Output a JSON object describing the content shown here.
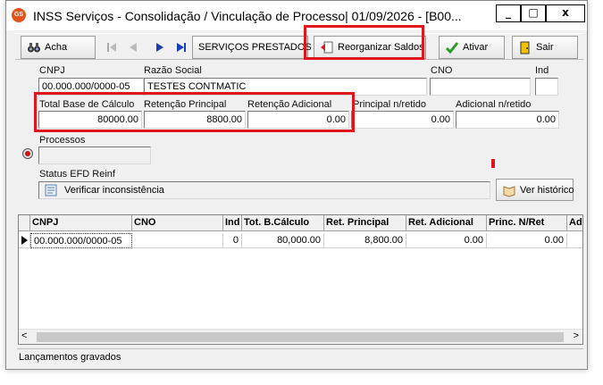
{
  "window": {
    "app_icon_text": "GS",
    "title": "INSS Serviços - Consolidação / Vinculação de Processo|  01/09/2026 - [B00...",
    "controls": {
      "minimize": "_",
      "maximize": "□",
      "close": "x"
    }
  },
  "toolbar": {
    "acha": "Acha",
    "servicos_prestados": "SERVIÇOS PRESTADOS",
    "reorganizar_saldos": "Reorganizar Saldos",
    "ativar": "Ativar",
    "sair": "Sair"
  },
  "form": {
    "cnpj_label": "CNPJ",
    "cnpj_value": "00.000.000/0000-05",
    "razao_social_label": "Razão Social",
    "razao_social_value": "TESTES CONTMATIC",
    "cno_label": "CNO",
    "cno_value": "",
    "ind_label": "Ind",
    "ind_value": "",
    "total_base_label": "Total Base de Cálculo",
    "total_base_value": "80000.00",
    "retencao_principal_label": "Retenção Principal",
    "retencao_principal_value": "8800.00",
    "retencao_adicional_label": "Retenção Adicional",
    "retencao_adicional_value": "0.00",
    "principal_nretido_label": "Principal n/retido",
    "principal_nretido_value": "0.00",
    "adicional_nretido_label": "Adicional n/retido",
    "adicional_nretido_value": "0.00",
    "processos_label": "Processos",
    "processos_value": "",
    "status_label": "Status EFD Reinf",
    "status_value": "Verificar inconsistência",
    "ver_historico": "Ver histórico"
  },
  "grid": {
    "columns": [
      "CNPJ",
      "CNO",
      "Ind",
      "Tot. B.Cálculo",
      "Ret. Principal",
      "Ret. Adicional",
      "Princ. N/Ret",
      "Ad"
    ],
    "rows": [
      [
        "00.000.000/0000-05",
        "",
        "0",
        "80,000.00",
        "8,800.00",
        "0.00",
        "0.00",
        ""
      ]
    ]
  },
  "status_bar": "Lançamentos gravados",
  "colors": {
    "highlight": "#e0161d",
    "accent": "#1a3fb0"
  }
}
